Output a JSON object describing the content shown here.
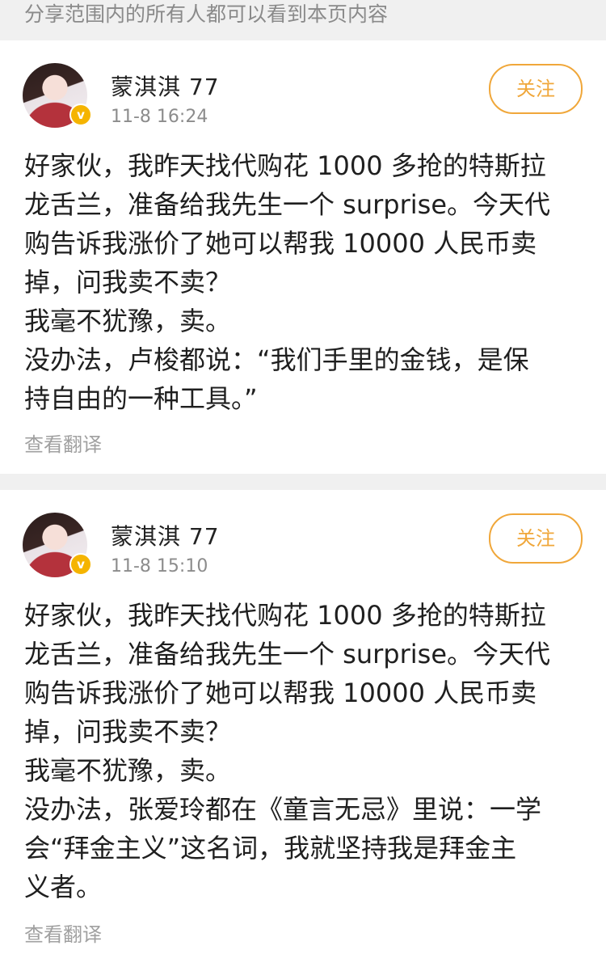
{
  "notice": "分享范围内的所有人都可以看到本页内容",
  "posts": [
    {
      "author": "蒙淇淇 77",
      "time": "11-8 16:24",
      "follow_label": "关注",
      "verified_mark": "v",
      "lines": [
        "好家伙，我昨天找代购花 1000 多抢的特斯拉",
        "龙舌兰，准备给我先生一个 surprise。今天代",
        "购告诉我涨价了她可以帮我 10000 人民币卖",
        "掉，问我卖不卖？",
        "我毫不犹豫，卖。",
        "没办法，卢梭都说：“我们手里的金钱，是保",
        "持自由的一种工具。”"
      ],
      "translate_label": "查看翻译"
    },
    {
      "author": "蒙淇淇 77",
      "time": "11-8 15:10",
      "follow_label": "关注",
      "verified_mark": "v",
      "lines": [
        "好家伙，我昨天找代购花 1000 多抢的特斯拉",
        "龙舌兰，准备给我先生一个 surprise。今天代",
        "购告诉我涨价了她可以帮我 10000 人民币卖",
        "掉，问我卖不卖？",
        "我毫不犹豫，卖。",
        "没办法，张爱玲都在《童言无忌》里说：一学",
        "会“拜金主义”这名词，我就坚持我是拜金主",
        "义者。"
      ],
      "translate_label": "查看翻译"
    }
  ],
  "colors": {
    "accent": "#f0a73a",
    "verified": "#f5b400",
    "muted": "#8c8c8c",
    "background": "#f0f0f0"
  }
}
